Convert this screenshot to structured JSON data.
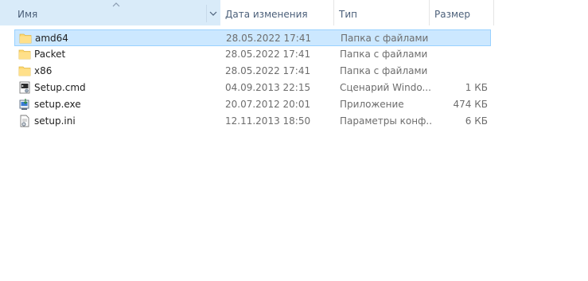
{
  "columns": {
    "name": "Имя",
    "date": "Дата изменения",
    "type": "Тип",
    "size": "Размер"
  },
  "sort": {
    "column": "name",
    "direction": "ascending",
    "sort_icon": "chevron-up-icon",
    "dropdown_icon": "chevron-down-icon"
  },
  "files": [
    {
      "name": "amd64",
      "date": "28.05.2022 17:41",
      "type": "Папка с файлами",
      "size": "",
      "icon": "folder-icon",
      "selected": true
    },
    {
      "name": "Packet",
      "date": "28.05.2022 17:41",
      "type": "Папка с файлами",
      "size": "",
      "icon": "folder-icon",
      "selected": false
    },
    {
      "name": "x86",
      "date": "28.05.2022 17:41",
      "type": "Папка с файлами",
      "size": "",
      "icon": "folder-icon",
      "selected": false
    },
    {
      "name": "Setup.cmd",
      "date": "04.09.2013 22:15",
      "type": "Сценарий Windo...",
      "size": "1 КБ",
      "icon": "script-file-icon",
      "selected": false
    },
    {
      "name": "setup.exe",
      "date": "20.07.2012 20:01",
      "type": "Приложение",
      "size": "474 КБ",
      "icon": "installer-icon",
      "selected": false
    },
    {
      "name": "setup.ini",
      "date": "12.11.2013 18:50",
      "type": "Параметры конф...",
      "size": "6 КБ",
      "icon": "settings-file-icon",
      "selected": false
    }
  ],
  "colors": {
    "header_sorted_bg": "#d9ebf9",
    "selection_bg": "#cce8ff",
    "selection_border": "#99d1ff",
    "header_text": "#4c607a",
    "secondary_text": "#6d6d6d",
    "folder": "#ffd86f"
  }
}
